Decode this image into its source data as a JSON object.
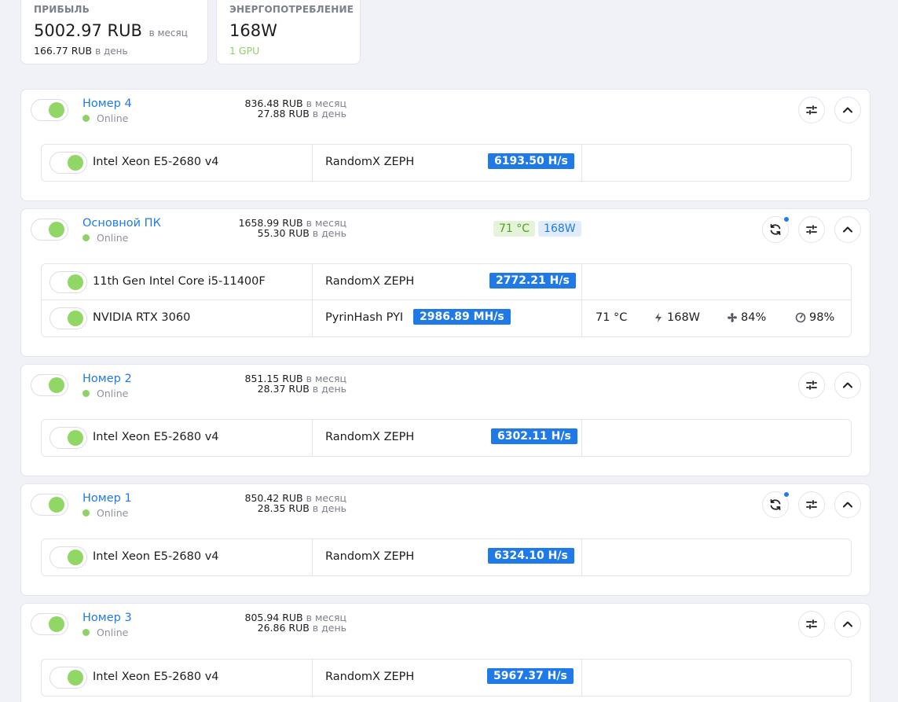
{
  "profit": {
    "label": "ПРИБЫЛЬ",
    "monthly_value": "5002.97 RUB",
    "monthly_unit": "в месяц",
    "daily_value": "166.77 RUB",
    "daily_unit": "в день"
  },
  "power": {
    "label": "ЭНЕРГОПОТРЕБЛЕНИЕ",
    "value": "168W",
    "gpu_count": "1 GPU"
  },
  "rigs": [
    {
      "name": "Номер 4",
      "status": "Online",
      "monthly": "836.48 RUB",
      "monthly_unit": "в месяц",
      "daily": "27.88 RUB",
      "daily_unit": "в день",
      "devices": [
        {
          "name": "Intel Xeon E5-2680 v4",
          "algo": "RandomX ZEPH",
          "hashrate": "6193.50 H/s"
        }
      ]
    },
    {
      "name": "Основной ПК",
      "status": "Online",
      "monthly": "1658.99 RUB",
      "monthly_unit": "в месяц",
      "daily": "55.30 RUB",
      "daily_unit": "в день",
      "temp_badge": "71 °C",
      "power_badge": "168W",
      "devices": [
        {
          "name": "11th Gen Intel Core i5-11400F",
          "algo": "RandomX ZEPH",
          "hashrate": "2772.21 H/s"
        },
        {
          "name": "NVIDIA RTX 3060",
          "algo": "PyrinHash PYI",
          "hashrate": "2986.89 MH/s",
          "temp": "71 °C",
          "power": "168W",
          "fan": "84%",
          "load": "98%"
        }
      ]
    },
    {
      "name": "Номер 2",
      "status": "Online",
      "monthly": "851.15 RUB",
      "monthly_unit": "в месяц",
      "daily": "28.37 RUB",
      "daily_unit": "в день",
      "devices": [
        {
          "name": "Intel Xeon E5-2680 v4",
          "algo": "RandomX ZEPH",
          "hashrate": "6302.11 H/s"
        }
      ]
    },
    {
      "name": "Номер 1",
      "status": "Online",
      "monthly": "850.42 RUB",
      "monthly_unit": "в месяц",
      "daily": "28.35 RUB",
      "daily_unit": "в день",
      "devices": [
        {
          "name": "Intel Xeon E5-2680 v4",
          "algo": "RandomX ZEPH",
          "hashrate": "6324.10 H/s"
        }
      ]
    },
    {
      "name": "Номер 3",
      "status": "Online",
      "monthly": "805.94 RUB",
      "monthly_unit": "в месяц",
      "daily": "26.86 RUB",
      "daily_unit": "в день",
      "devices": [
        {
          "name": "Intel Xeon E5-2680 v4",
          "algo": "RandomX ZEPH",
          "hashrate": "5967.37 H/s"
        }
      ]
    }
  ],
  "icons": {
    "restart": "restart-icon",
    "settings": "sliders-icon",
    "collapse": "chevron-up-icon",
    "power": "bolt-icon",
    "fan": "fan-icon",
    "load": "gauge-icon"
  },
  "colors": {
    "accent": "#1f7ae8",
    "online": "#8dd262",
    "toggle_on": "#91d765",
    "temp_badge_bg": "#e4f3d9",
    "temp_badge_text": "#4aa31e"
  }
}
